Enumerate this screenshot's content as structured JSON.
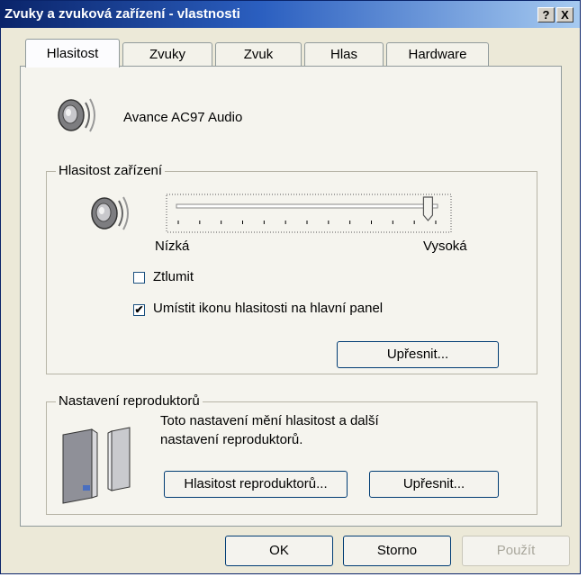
{
  "window": {
    "title": "Zvuky a zvuková zařízení - vlastnosti",
    "help_label": "?",
    "close_label": "X"
  },
  "tabs": [
    {
      "label": "Hlasitost",
      "active": true
    },
    {
      "label": "Zvuky",
      "active": false
    },
    {
      "label": "Zvuk",
      "active": false
    },
    {
      "label": "Hlas",
      "active": false
    },
    {
      "label": "Hardware",
      "active": false
    }
  ],
  "device": {
    "name": "Avance AC97 Audio"
  },
  "volume_group": {
    "legend": "Hlasitost zařízení",
    "low_label": "Nízká",
    "high_label": "Vysoká",
    "slider_level": 0.97,
    "mute": {
      "label": "Ztlumit",
      "checked": false
    },
    "tray_icon": {
      "label": "Umístit ikonu hlasitosti na hlavní panel",
      "checked": true
    },
    "advanced_label": "Upřesnit..."
  },
  "speaker_group": {
    "legend": "Nastavení reproduktorů",
    "description": "Toto nastavení mění hlasitost a další nastavení reproduktorů.",
    "speaker_volume_label": "Hlasitost reproduktorů...",
    "advanced_label": "Upřesnit..."
  },
  "footer": {
    "ok_label": "OK",
    "cancel_label": "Storno",
    "apply_label": "Použít"
  }
}
